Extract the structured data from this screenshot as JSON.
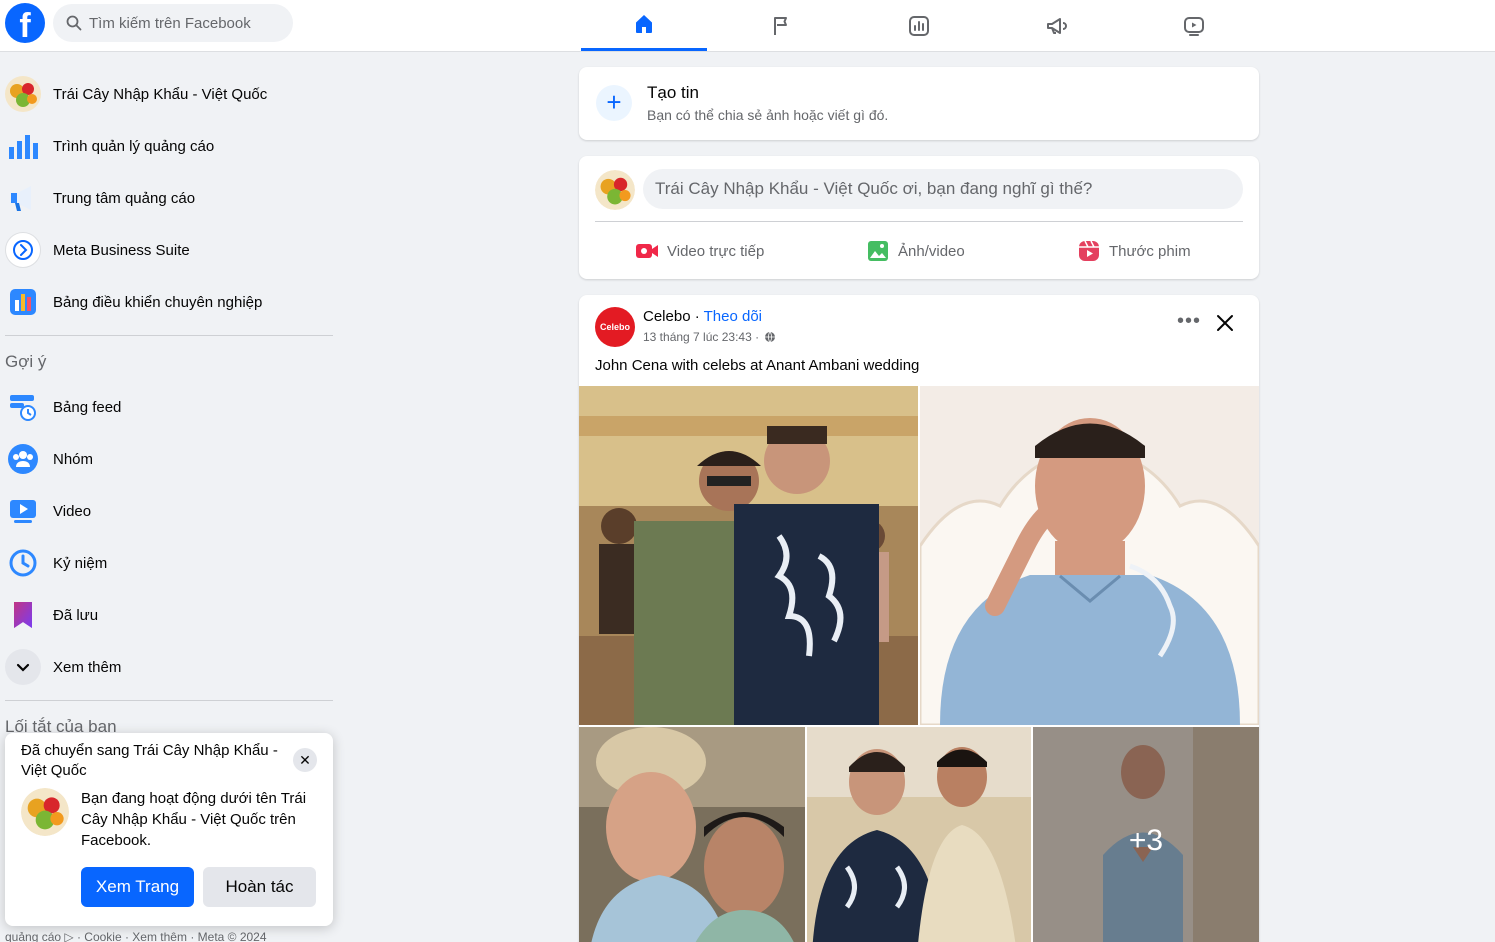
{
  "header": {
    "logo": "f",
    "search_placeholder": "Tìm kiếm trên Facebook",
    "tabs": [
      {
        "icon": "home-icon",
        "active": true
      },
      {
        "icon": "flag-icon",
        "active": false
      },
      {
        "icon": "insights-icon",
        "active": false
      },
      {
        "icon": "megaphone-icon",
        "active": false
      },
      {
        "icon": "video-icon",
        "active": false
      }
    ]
  },
  "sidebar": {
    "items": [
      {
        "label": "Trái Cây Nhập Khẩu - Việt Quốc",
        "icon": "fruit-avatar"
      },
      {
        "label": "Trình quản lý quảng cáo",
        "icon": "bar-chart-icon"
      },
      {
        "label": "Trung tâm quảng cáo",
        "icon": "megaphone-icon"
      },
      {
        "label": "Meta Business Suite",
        "icon": "business-suite-icon"
      },
      {
        "label": "Bảng điều khiển chuyên nghiệp",
        "icon": "dashboard-icon"
      }
    ],
    "suggest_title": "Gợi ý",
    "suggest_items": [
      {
        "label": "Bảng feed",
        "icon": "feed-icon"
      },
      {
        "label": "Nhóm",
        "icon": "groups-icon"
      },
      {
        "label": "Video",
        "icon": "video-icon"
      },
      {
        "label": "Kỷ niệm",
        "icon": "memories-icon"
      },
      {
        "label": "Đã lưu",
        "icon": "saved-icon"
      },
      {
        "label": "Xem thêm",
        "icon": "chevron-down-icon"
      }
    ],
    "shortcuts_title": "Lối tắt của bạn",
    "footer": "quảng cáo ▷ · Cookie · Xem thêm · Meta © 2024"
  },
  "toast": {
    "title": "Đã chuyển sang Trái Cây Nhập Khẩu - Việt Quốc",
    "body": "Bạn đang hoạt động dưới tên Trái Cây Nhập Khẩu - Việt Quốc trên Facebook.",
    "primary_button": "Xem Trang",
    "secondary_button": "Hoàn tác",
    "close": "✕"
  },
  "create_story": {
    "title": "Tạo tin",
    "subtitle": "Bạn có thể chia sẻ ảnh hoặc viết gì đó."
  },
  "composer": {
    "placeholder": "Trái Cây Nhập Khẩu - Việt Quốc ơi, bạn đang nghĩ gì thế?",
    "actions": [
      {
        "label": "Video trực tiếp",
        "icon": "live-video-icon",
        "color": "#f02849"
      },
      {
        "label": "Ảnh/video",
        "icon": "photo-icon",
        "color": "#45bd62"
      },
      {
        "label": "Thước phim",
        "icon": "reels-icon",
        "color": "#f02849"
      }
    ]
  },
  "post": {
    "page_name": "Celebo",
    "page_logo_text": "Celebo",
    "separator": "·",
    "follow_label": "Theo dõi",
    "timestamp": "13 tháng 7 lúc 23:43 ·",
    "caption": "John Cena with celebs at Anant Ambani wedding",
    "more_photos": "+3",
    "more_label": "•••"
  },
  "colors": {
    "brand": "#0866ff",
    "background": "#f0f2f5",
    "secondary_text": "#65676b"
  }
}
